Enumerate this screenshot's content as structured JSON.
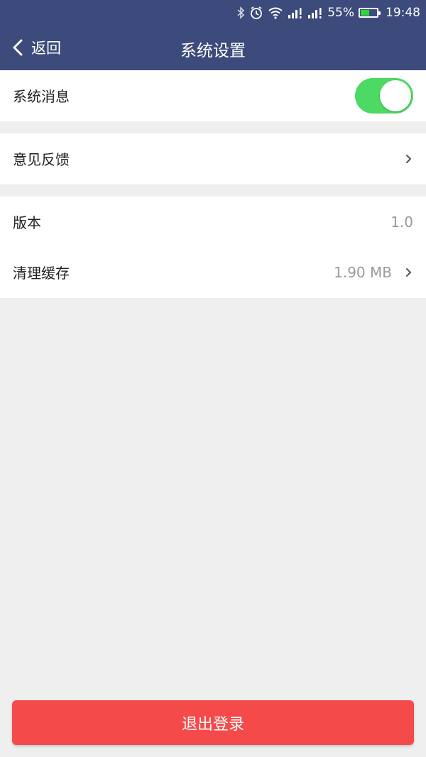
{
  "status_bar": {
    "icons": [
      "bluetooth-icon",
      "alarm-icon",
      "wifi-icon",
      "signal-icon",
      "signal-icon"
    ],
    "battery_percent_text": "55%",
    "battery_level": 0.55,
    "time": "19:48"
  },
  "nav": {
    "back_label": "返回",
    "title": "系统设置"
  },
  "settings": {
    "system_message": {
      "label": "系统消息",
      "toggle_on": true
    },
    "feedback": {
      "label": "意见反馈"
    },
    "version": {
      "label": "版本",
      "value": "1.0"
    },
    "clear_cache": {
      "label": "清理缓存",
      "value": "1.90 MB"
    }
  },
  "logout_label": "退出登录",
  "colors": {
    "header_bg": "#3c4b7b",
    "toggle_on": "#4cd964",
    "logout_bg": "#f54a4a",
    "page_bg": "#efefef"
  }
}
